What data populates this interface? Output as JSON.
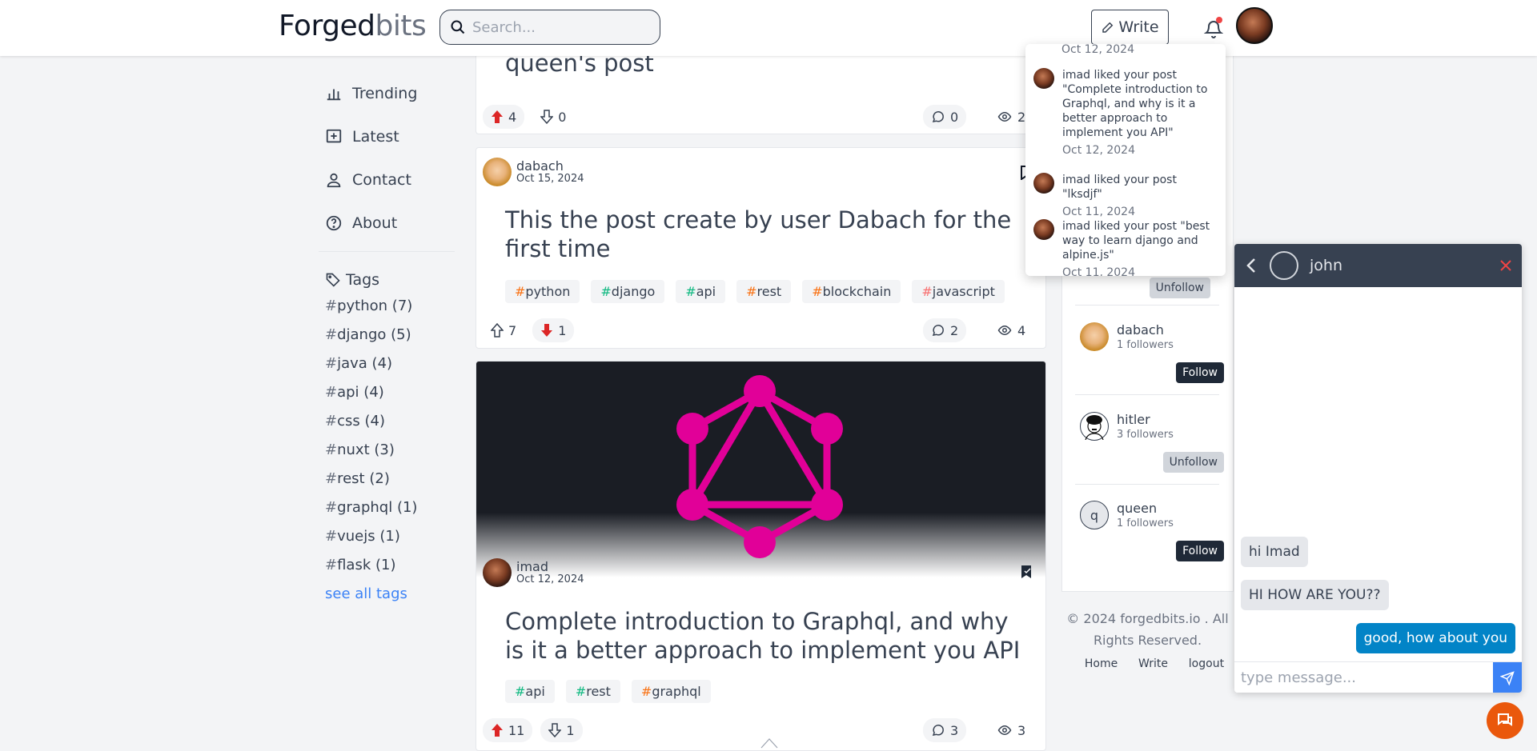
{
  "header": {
    "logo_main": "Forged",
    "logo_accent": "bits",
    "search_placeholder": "Search...",
    "write_label": "Write"
  },
  "nav": {
    "items": [
      {
        "label": "Trending",
        "icon": "chart-icon"
      },
      {
        "label": "Latest",
        "icon": "plus-square-icon"
      },
      {
        "label": "Contact",
        "icon": "user-icon"
      },
      {
        "label": "About",
        "icon": "question-icon"
      }
    ],
    "tags_heading": "Tags",
    "tags": [
      {
        "name": "python",
        "count": "(7)"
      },
      {
        "name": "django",
        "count": "(5)"
      },
      {
        "name": "java",
        "count": "(4)"
      },
      {
        "name": "api",
        "count": "(4)"
      },
      {
        "name": "css",
        "count": "(4)"
      },
      {
        "name": "nuxt",
        "count": "(3)"
      },
      {
        "name": "rest",
        "count": "(2)"
      },
      {
        "name": "graphql",
        "count": "(1)"
      },
      {
        "name": "vuejs",
        "count": "(1)"
      },
      {
        "name": "flask",
        "count": "(1)"
      }
    ],
    "see_all": "see all tags"
  },
  "posts": [
    {
      "title": "queen's post",
      "up": "4",
      "down": "0",
      "comments": "0",
      "views": "2"
    },
    {
      "author": "dabach",
      "date": "Oct 15, 2024",
      "title": "This the post create by user Dabach for the first time",
      "tags": [
        {
          "name": "python",
          "color": "#f97316"
        },
        {
          "name": "django",
          "color": "#10b981"
        },
        {
          "name": "api",
          "color": "#10b981"
        },
        {
          "name": "rest",
          "color": "#f97316"
        },
        {
          "name": "blockchain",
          "color": "#f97316"
        },
        {
          "name": "javascript",
          "color": "#f87171"
        }
      ],
      "up": "7",
      "down": "1",
      "comments": "2",
      "views": "4"
    },
    {
      "author": "imad",
      "date": "Oct 12, 2024",
      "title": "Complete introduction to Graphql, and why is it a better approach to implement you API",
      "tags": [
        {
          "name": "api",
          "color": "#10b981"
        },
        {
          "name": "rest",
          "color": "#10b981"
        },
        {
          "name": "graphql",
          "color": "#f97316"
        }
      ],
      "up": "11",
      "down": "1",
      "comments": "3",
      "views": "3"
    }
  ],
  "notifications": [
    {
      "text": "",
      "date": "Oct 12, 2024"
    },
    {
      "text": "imad liked your post \"Complete introduction to Graphql, and why is it a better approach to implement you API\"",
      "date": "Oct 12, 2024"
    },
    {
      "text": "imad liked your post \"lksdjf\"",
      "date": "Oct 11, 2024"
    },
    {
      "text": "imad liked your post \"best way to learn django and alpine.js\"",
      "date": "Oct 11, 2024"
    }
  ],
  "suggestions": [
    {
      "btn": "Unfollow"
    },
    {
      "name": "dabach",
      "followers": "1 followers",
      "btn": "Follow"
    },
    {
      "name": "hitler",
      "followers": "3 followers",
      "btn": "Unfollow"
    },
    {
      "name": "queen",
      "initial": "q",
      "followers": "1 followers",
      "btn": "Follow"
    }
  ],
  "footer": {
    "copyright": "© 2024 forgedbits.io . All Rights Reserved.",
    "links": [
      "Home",
      "Write",
      "logout"
    ]
  },
  "chat": {
    "name": "john",
    "messages": [
      {
        "text": "hi Imad",
        "dir": "in"
      },
      {
        "text": "HI HOW ARE YOU??",
        "dir": "in"
      },
      {
        "text": "good, how about you",
        "dir": "out"
      }
    ],
    "placeholder": "type message..."
  },
  "colors": {
    "accent": "#3b82f6",
    "chat_out": "#0284c7",
    "upvote": "#dc2626",
    "fab": "#ea580c"
  }
}
